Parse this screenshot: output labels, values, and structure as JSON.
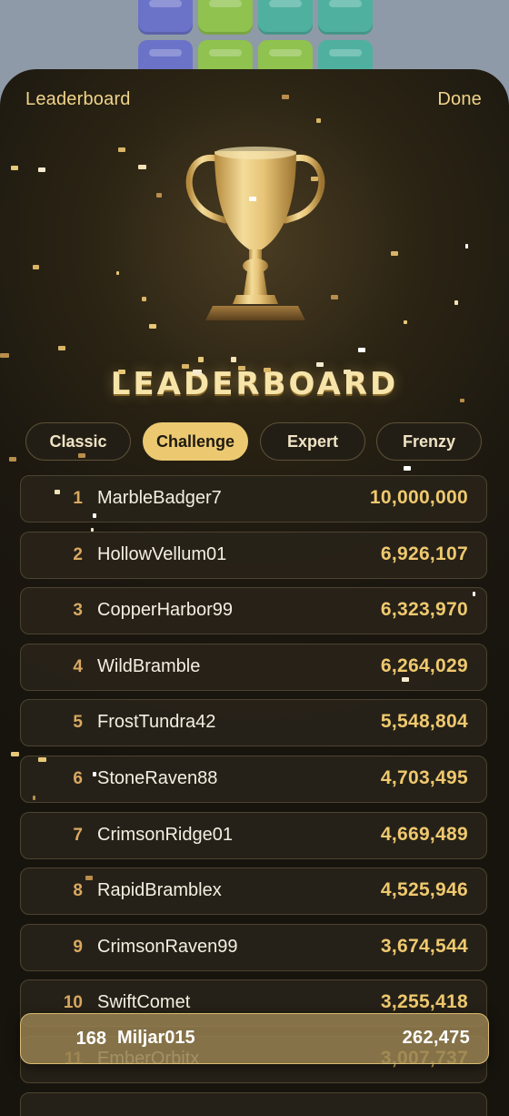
{
  "header": {
    "left_label": "Leaderboard",
    "right_label": "Done"
  },
  "banner": {
    "title": "LEADERBOARD"
  },
  "tabs": [
    {
      "label": "Classic",
      "active": false
    },
    {
      "label": "Challenge",
      "active": true
    },
    {
      "label": "Expert",
      "active": false
    },
    {
      "label": "Frenzy",
      "active": false
    }
  ],
  "entries": [
    {
      "rank": "1",
      "name": "MarbleBadger7",
      "score": "10,000,000"
    },
    {
      "rank": "2",
      "name": "HollowVellum01",
      "score": "6,926,107"
    },
    {
      "rank": "3",
      "name": "CopperHarbor99",
      "score": "6,323,970"
    },
    {
      "rank": "4",
      "name": "WildBramble",
      "score": "6,264,029"
    },
    {
      "rank": "5",
      "name": "FrostTundra42",
      "score": "5,548,804"
    },
    {
      "rank": "6",
      "name": "StoneRaven88",
      "score": "4,703,495"
    },
    {
      "rank": "7",
      "name": "CrimsonRidge01",
      "score": "4,669,489"
    },
    {
      "rank": "8",
      "name": "RapidBramblex",
      "score": "4,525,946"
    },
    {
      "rank": "9",
      "name": "CrimsonRaven99",
      "score": "3,674,544"
    },
    {
      "rank": "10",
      "name": "SwiftComet",
      "score": "3,255,418"
    },
    {
      "rank": "11",
      "name": "EmberOrbitx",
      "score": "3,007,737"
    }
  ],
  "current_user": {
    "rank": "168",
    "name": "Miljar015",
    "score": "262,475"
  },
  "colors": {
    "accent_gold": "#ecc971",
    "rank_gold": "#d9a960",
    "panel_dark": "#17140e",
    "tile_blue": "#6b73c8",
    "tile_green": "#8fc24e",
    "tile_teal": "#4fb0a0"
  }
}
